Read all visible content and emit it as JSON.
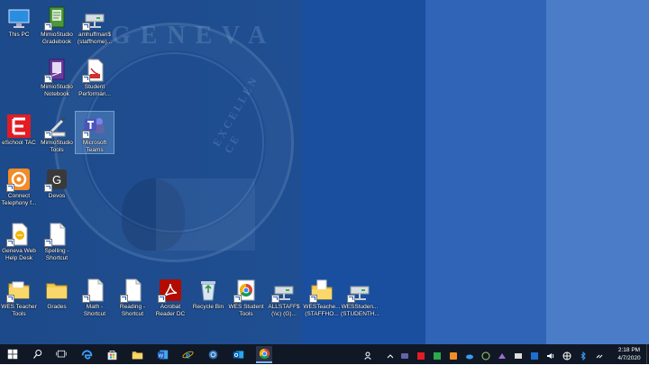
{
  "desktop": {
    "seal_text_top": "G E N E V A",
    "seal_text_right": "E X C E L L E N C E",
    "icons": [
      {
        "label": "This PC"
      },
      {
        "label": "MimioStudio\nGradebook"
      },
      {
        "label": "amhuffman$\n(staffhome)..."
      },
      {
        "label": "MimioStudio\nNotebook"
      },
      {
        "label": "Student\nPerforman..."
      },
      {
        "label": "eSchool TAC"
      },
      {
        "label": "MimioStudio\nTools"
      },
      {
        "label": "Microsoft\nTeams"
      },
      {
        "label": "Connect\nTelephony f..."
      },
      {
        "label": "Devos"
      },
      {
        "label": "Geneva Web\nHelp Desk"
      },
      {
        "label": "Spelling -\nShortcut"
      },
      {
        "label": "WES Teacher\nTools"
      },
      {
        "label": "Grades"
      },
      {
        "label": "Math -\nShortcut"
      },
      {
        "label": "Reading -\nShortcut"
      },
      {
        "label": "Acrobat\nReader DC"
      },
      {
        "label": "Recycle Bin"
      },
      {
        "label": "WES Student\nTools"
      },
      {
        "label": "ALLSTAFF$\n(\\\\c) (G)..."
      },
      {
        "label": "WESTeache...\n(STAFFHO..."
      },
      {
        "label": "WESStuden...\n(STUDENTH..."
      }
    ]
  },
  "taskbar": {
    "time": "2:18 PM",
    "date": "4/7/2020"
  }
}
